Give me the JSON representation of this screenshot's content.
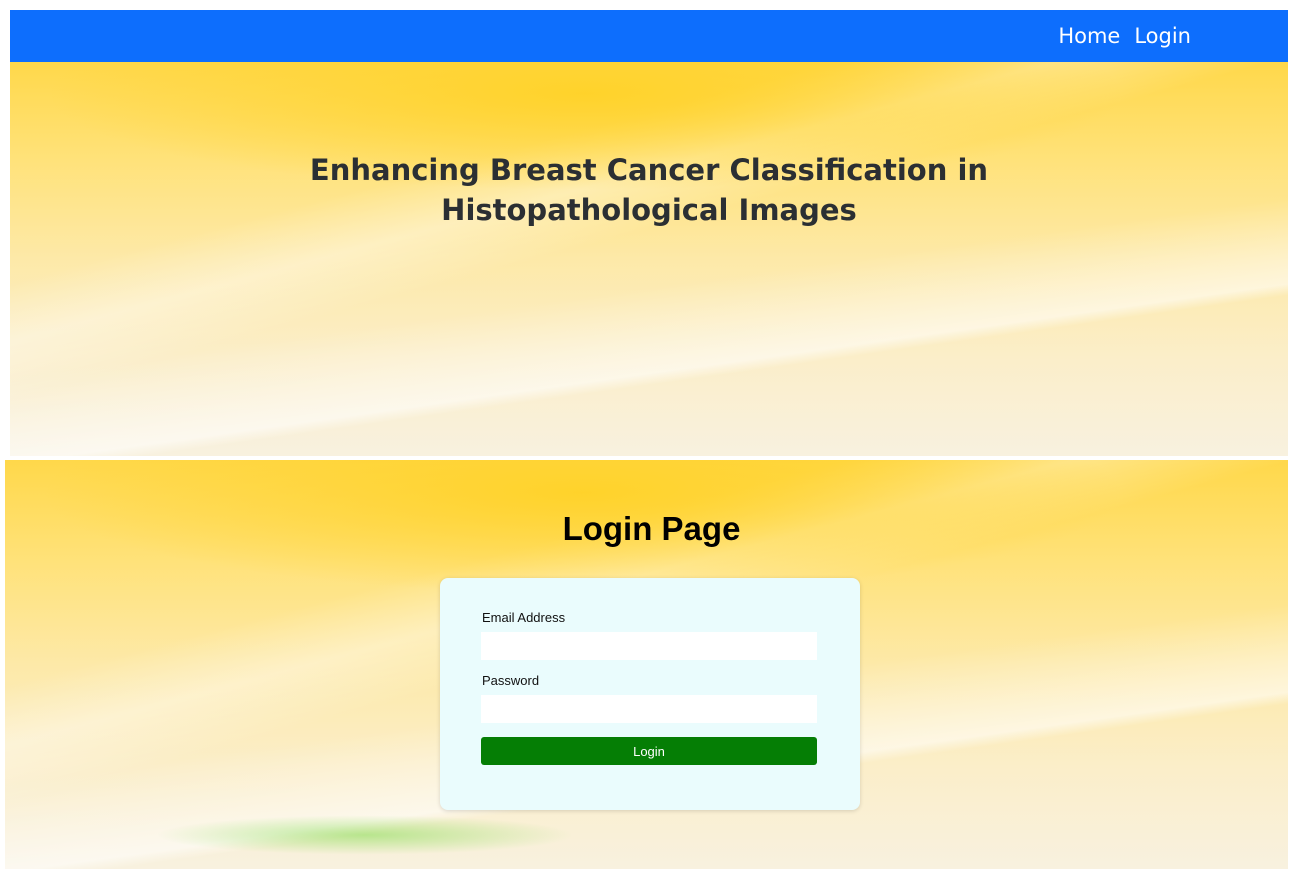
{
  "navbar": {
    "links": [
      "Home",
      "Login"
    ],
    "color": "#0d6efd"
  },
  "hero": {
    "title_line1": "Enhancing Breast Cancer Classification in",
    "title_line2": "Histopathological Images"
  },
  "login": {
    "title": "Login Page",
    "email_label": "Email Address",
    "email_value": "",
    "password_label": "Password",
    "password_value": "",
    "button_label": "Login",
    "button_color": "#057e05",
    "card_color": "#eafcfd"
  }
}
